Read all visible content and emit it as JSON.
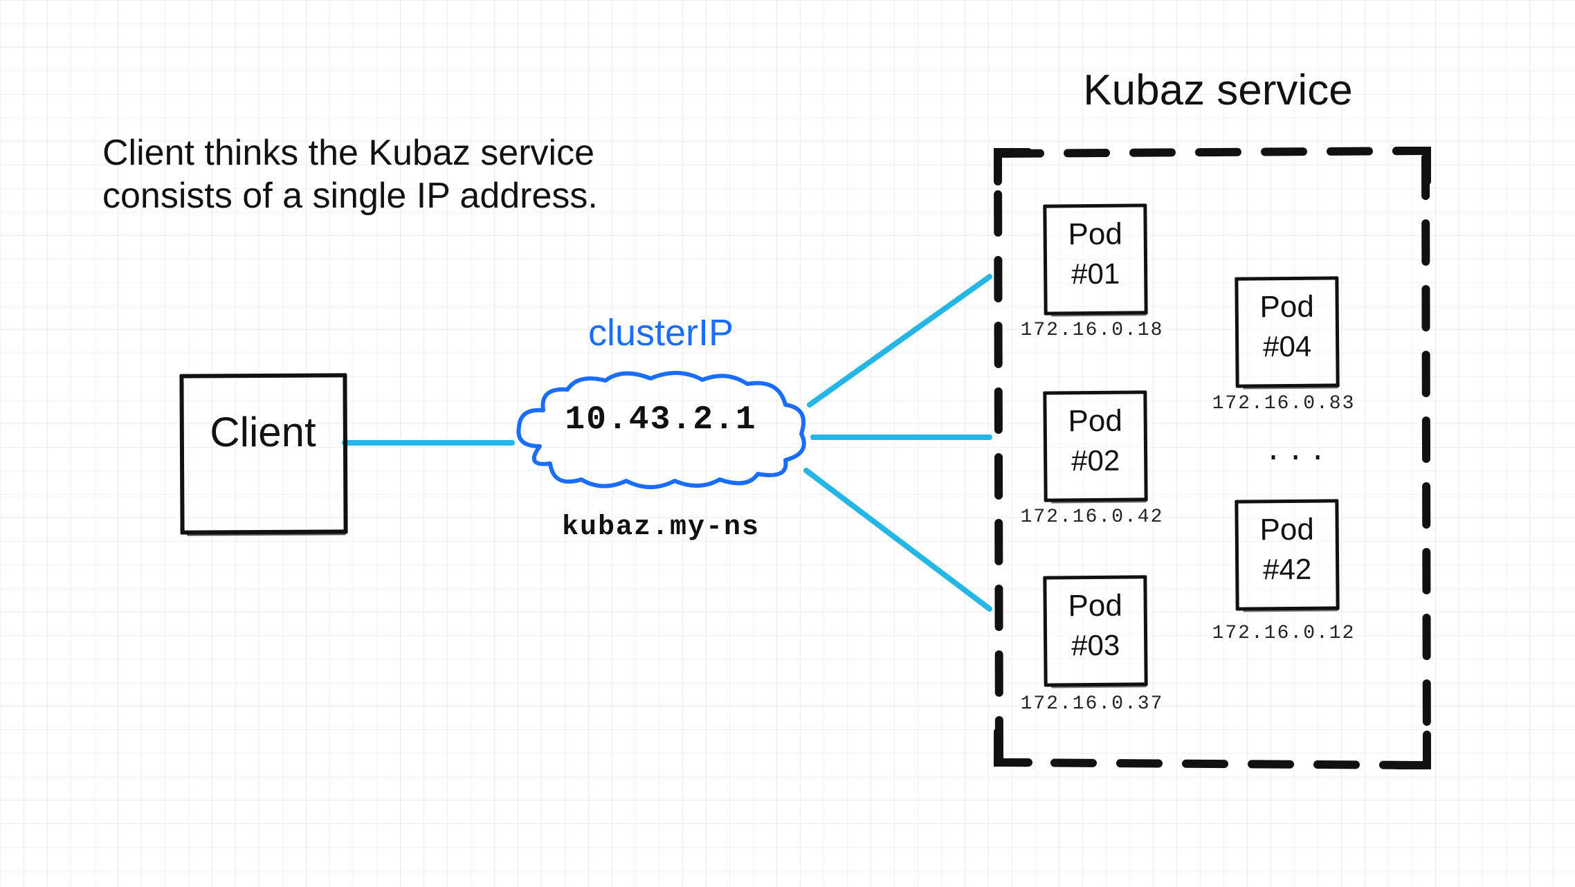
{
  "caption": "Client thinks the Kubaz service consists of a single IP address.",
  "client_label": "Client",
  "cluster": {
    "heading": "clusterIP",
    "ip": "10.43.2.1",
    "dns": "kubaz.my-ns"
  },
  "service": {
    "title": "Kubaz service",
    "ellipsis": "..."
  },
  "pods": {
    "p1": {
      "name": "Pod",
      "num": "#01",
      "ip": "172.16.0.18"
    },
    "p2": {
      "name": "Pod",
      "num": "#02",
      "ip": "172.16.0.42"
    },
    "p3": {
      "name": "Pod",
      "num": "#03",
      "ip": "172.16.0.37"
    },
    "p4": {
      "name": "Pod",
      "num": "#04",
      "ip": "172.16.0.83"
    },
    "p42": {
      "name": "Pod",
      "num": "#42",
      "ip": "172.16.0.12"
    }
  }
}
